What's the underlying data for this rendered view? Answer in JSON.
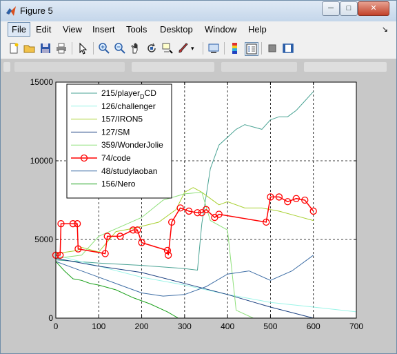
{
  "window": {
    "title": "Figure 5",
    "minimize_glyph": "─",
    "maximize_glyph": "□",
    "close_glyph": "✕"
  },
  "menu": {
    "items": [
      "File",
      "Edit",
      "View",
      "Insert",
      "Tools",
      "Desktop",
      "Window",
      "Help"
    ],
    "arrow": "↘"
  },
  "toolbar": {
    "icons": [
      "new-figure-icon",
      "open-file-icon",
      "save-icon",
      "print-icon",
      "pointer-icon",
      "zoom-in-icon",
      "zoom-out-icon",
      "pan-icon",
      "rotate-icon",
      "data-cursor-icon",
      "brush-icon",
      "link-icon",
      "colorbar-icon",
      "legend-icon",
      "hide-tools-icon",
      "show-tools-icon"
    ]
  },
  "colors": {
    "accent": "#ff0000",
    "axes_bg": "#ffffff",
    "figure_bg": "#c8c8c8"
  },
  "chart_data": {
    "type": "line",
    "title": "",
    "xlabel": "",
    "ylabel": "",
    "xlim": [
      0,
      700
    ],
    "ylim": [
      0,
      15000
    ],
    "xticks": [
      0,
      100,
      200,
      300,
      400,
      500,
      600,
      700
    ],
    "yticks": [
      0,
      5000,
      10000,
      15000
    ],
    "grid": true,
    "legend_position": "top-left",
    "series": [
      {
        "name": "215/player",
        "name_sub": "D",
        "name_tail": "CD",
        "color": "#4aa394",
        "marker": "",
        "x": [
          0,
          100,
          200,
          300,
          330,
          340,
          360,
          380,
          420,
          440,
          480,
          500,
          520,
          540,
          560,
          580,
          600
        ],
        "y": [
          3700,
          3500,
          3350,
          3150,
          3050,
          6000,
          9500,
          11000,
          12000,
          12300,
          12000,
          12600,
          12800,
          12800,
          13200,
          13800,
          14400
        ]
      },
      {
        "name": "126/challenger",
        "color": "#9bf5e8",
        "marker": "",
        "x": [
          0,
          100,
          200,
          300,
          400,
          500,
          600,
          700
        ],
        "y": [
          4000,
          3300,
          2600,
          2100,
          1500,
          1000,
          700,
          400
        ]
      },
      {
        "name": "157/IRON5",
        "color": "#a8d030",
        "marker": "",
        "x": [
          0,
          50,
          60,
          100,
          140,
          180,
          240,
          280,
          300,
          320,
          340,
          360,
          380,
          400,
          440,
          480,
          520,
          560,
          600
        ],
        "y": [
          4100,
          4300,
          4500,
          4200,
          5500,
          5700,
          6100,
          6900,
          8000,
          8300,
          8000,
          7600,
          7200,
          7400,
          7000,
          7000,
          6800,
          6500,
          6200
        ]
      },
      {
        "name": "127/SM",
        "color": "#1a3f80",
        "marker": "",
        "x": [
          0,
          100,
          200,
          300,
          400,
          500,
          600
        ],
        "y": [
          3800,
          3300,
          2900,
          2200,
          1500,
          700,
          0
        ]
      },
      {
        "name": "359/WonderJolie",
        "color": "#8ee07a",
        "marker": "",
        "x": [
          0,
          60,
          100,
          150,
          200,
          250,
          300,
          340,
          360,
          400,
          420,
          460
        ],
        "y": [
          3800,
          4000,
          5200,
          5800,
          6400,
          7500,
          7900,
          8000,
          6200,
          5600,
          500,
          0
        ]
      },
      {
        "name": "74/code",
        "color": "#ff0000",
        "marker": "o",
        "x": [
          0,
          10,
          12,
          40,
          50,
          52,
          115,
          120,
          150,
          180,
          190,
          200,
          260,
          262,
          270,
          290,
          310,
          330,
          340,
          350,
          370,
          380,
          490,
          500,
          520,
          540,
          560,
          580,
          600
        ],
        "y": [
          4000,
          4000,
          6000,
          6000,
          6000,
          4400,
          4100,
          5200,
          5200,
          5600,
          5600,
          4800,
          4300,
          4000,
          6100,
          7000,
          6800,
          6700,
          6700,
          6900,
          6400,
          6600,
          6100,
          7700,
          7700,
          7400,
          7600,
          7500,
          6800
        ]
      },
      {
        "name": "48/studylaoban",
        "color": "#3d6da5",
        "marker": "",
        "x": [
          0,
          50,
          100,
          150,
          200,
          250,
          300,
          350,
          400,
          450,
          500,
          550,
          600
        ],
        "y": [
          3600,
          3100,
          2600,
          2100,
          1600,
          1400,
          1500,
          2000,
          2800,
          3000,
          2400,
          3000,
          4000
        ]
      },
      {
        "name": "156/Nero",
        "color": "#1aa01a",
        "marker": "",
        "x": [
          0,
          20,
          40,
          60,
          80,
          100,
          140,
          180,
          220,
          260,
          285
        ],
        "y": [
          3600,
          3000,
          2500,
          2400,
          2200,
          2100,
          1800,
          1300,
          900,
          400,
          0
        ]
      }
    ]
  }
}
